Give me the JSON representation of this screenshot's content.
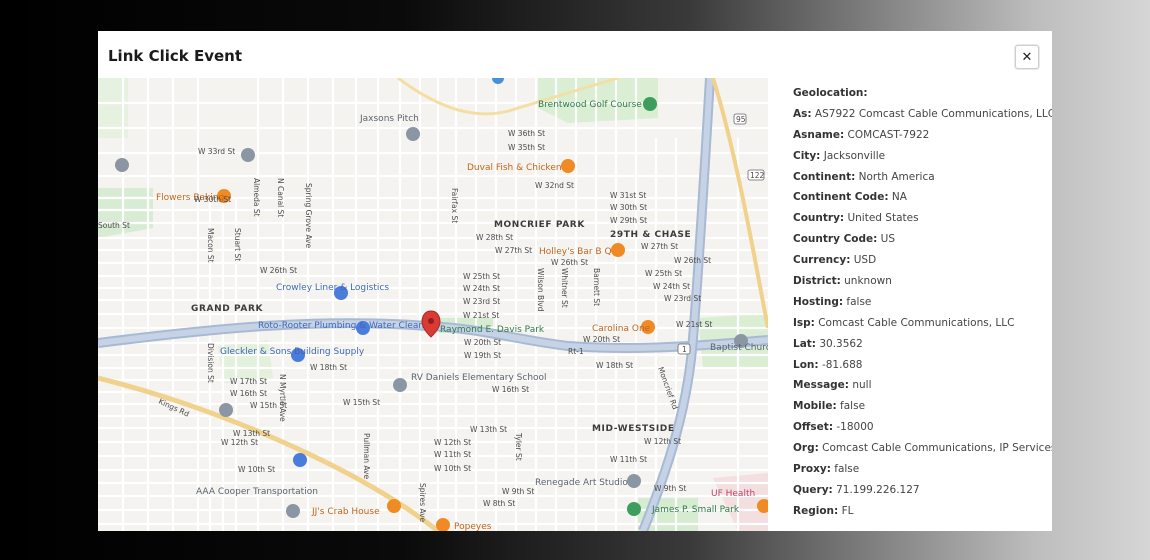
{
  "modal": {
    "title": "Link Click Event",
    "close_icon": "close-icon",
    "close_glyph": "✕"
  },
  "map": {
    "pin_color": "#d93a34",
    "areas": [
      "MONCRIEF PARK",
      "29TH & CHASE",
      "GRAND PARK",
      "MID-WESTSIDE"
    ],
    "places": {
      "brentwood": "Brentwood Golf Course",
      "jaxsons": "Jaxsons Pitch",
      "duval": "Duval Fish & Chicken",
      "flowers": "Flowers Baking",
      "hollys": "Holley's Bar B Q",
      "crowley": "Crowley Liner & Logistics",
      "roto": "Roto-Rooter Plumbing & Water Cleanup",
      "raymond": "Raymond E. Davis Park",
      "carolina": "Carolina One",
      "gleckler": "Gleckler & Sons Building Supply",
      "rv_daniels": "RV Daniels Elementary School",
      "jj": "JJ's Crab House",
      "aaa": "AAA Cooper Transportation",
      "renegade": "Renegade Art Studio",
      "james": "James P. Small Park",
      "popeyes": "Popeyes",
      "uf": "UF Health",
      "baptist": "Baptist Churc"
    },
    "streets": {
      "w33rd": "W 33rd St",
      "w30th": "W 30th St",
      "w26th": "W 26th St",
      "w17th": "W 17th St",
      "w16th": "W 16th St",
      "w15th": "W 15th St",
      "w13th": "W 13th St",
      "w12th": "W 12th St",
      "w10th": "W 10th St",
      "w36th": "W 36th St",
      "w35th": "W 35th St",
      "w32nd": "W 32nd St",
      "w31st": "W 31st St",
      "w30th_e": "W 30th St",
      "w29th": "W 29th St",
      "w28th": "W 28th St",
      "w27th": "W 27th St",
      "w27th_e": "W 27th St",
      "w26th_m": "W 26th St",
      "w26th_e": "W 26th St",
      "w25th": "W 25th St",
      "w25th_e": "W 25th St",
      "w24th": "W 24th St",
      "w24th_e": "W 24th St",
      "w23rd": "W 23rd St",
      "w23rd_e": "W 23rd St",
      "w21st": "W 21st St",
      "w21st_e": "W 21st St",
      "w20th": "W 20th St",
      "w20th_e": "W 20th St",
      "w19th": "W 19th St",
      "w18th": "W 18th St",
      "w18th_e": "W 18th St",
      "w16th_m": "W 16th St",
      "w15th_m": "W 15th St",
      "w13th_m": "W 13th St",
      "w12th_m": "W 12th St",
      "w12th_e": "W 12th St",
      "w11th": "W 11th St",
      "w11th_e": "W 11th St",
      "w10th_m": "W 10th St",
      "w9th": "W 9th St",
      "w9th_e": "W 9th St",
      "w8th": "W 8th St",
      "south": "South St",
      "moncrief": "Moncrief Rd",
      "almeda": "Almeda St",
      "ncanal": "N Canal St",
      "division": "Division St",
      "nmyrtle": "N Myrtle Ave",
      "spires": "Spires Ave",
      "fairfax": "Fairfax St",
      "springgrove": "Spring Grove Ave",
      "macon": "Macon St",
      "stuart": "Stuart St",
      "wilson": "Wilson Blvd",
      "barnett": "Barnett St",
      "whitner": "Whitner St",
      "pullman": "Pullman Ave",
      "tyler": "Tyler St",
      "kings": "Kings Rd",
      "rt1": "Rt-1",
      "shield1": "1",
      "shield95": "95",
      "shield122": "122"
    }
  },
  "details": [
    {
      "key": "Geolocation:",
      "value": ""
    },
    {
      "key": "As:",
      "value": "AS7922 Comcast Cable Communications, LLC"
    },
    {
      "key": "Asname:",
      "value": "COMCAST-7922"
    },
    {
      "key": "City:",
      "value": "Jacksonville"
    },
    {
      "key": "Continent:",
      "value": "North America"
    },
    {
      "key": "Continent Code:",
      "value": "NA"
    },
    {
      "key": "Country:",
      "value": "United States"
    },
    {
      "key": "Country Code:",
      "value": "US"
    },
    {
      "key": "Currency:",
      "value": "USD"
    },
    {
      "key": "District:",
      "value": "unknown"
    },
    {
      "key": "Hosting:",
      "value": "false"
    },
    {
      "key": "Isp:",
      "value": "Comcast Cable Communications, LLC"
    },
    {
      "key": "Lat:",
      "value": "30.3562"
    },
    {
      "key": "Lon:",
      "value": "-81.688"
    },
    {
      "key": "Message:",
      "value": "null"
    },
    {
      "key": "Mobile:",
      "value": "false"
    },
    {
      "key": "Offset:",
      "value": "-18000"
    },
    {
      "key": "Org:",
      "value": "Comcast Cable Communications, IP Services"
    },
    {
      "key": "Proxy:",
      "value": "false"
    },
    {
      "key": "Query:",
      "value": "71.199.226.127"
    },
    {
      "key": "Region:",
      "value": "FL"
    }
  ]
}
